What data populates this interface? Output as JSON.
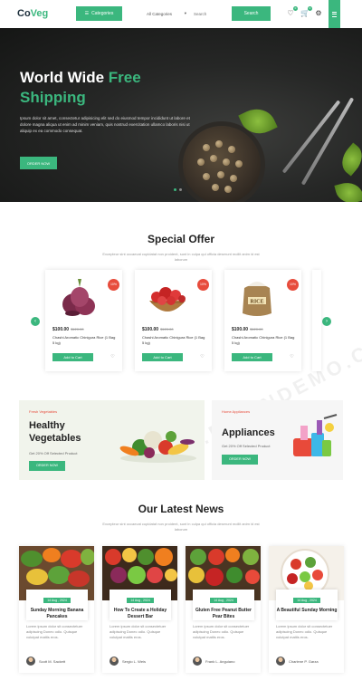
{
  "header": {
    "logo_main": "Co",
    "logo_accent": "Veg",
    "categories_button": "Categories",
    "category_select": "All Categories",
    "search_placeholder": "Search",
    "search_button": "Search",
    "wishlist_count": "0",
    "cart_count": "0"
  },
  "hero": {
    "title_line1": "World Wide",
    "title_accent": "Free",
    "title_line2": "Shipping",
    "description": "Ipsum dolor sit amet, consectetur adipisicing elit sed do eiusmod tempor incididunt ut labore et dolore magna aliqua ut enim ad minim veniam, quis nostrud exercitation ullamco laboris nisi ut aliquip ex ea commodo consequat.",
    "button": "ORDER NOW"
  },
  "special_offer": {
    "title": "Special Offer",
    "subtitle": "Excepteur sint occaecat cupidatat non proident, sunt in culpa qui officia deserunt mollit anim id est laborum",
    "products": [
      {
        "discount": "10%",
        "price": "$100.00",
        "old_price": "$120.00",
        "name": "Chashi Aromatic Chinigura Rice (1 Bag 5 kg)",
        "button": "Add to Cart"
      },
      {
        "discount": "10%",
        "price": "$100.00",
        "old_price": "$120.00",
        "name": "Chashi Aromatic Chinigura Rice (1 Bag 5 kg)",
        "button": "Add to Cart"
      },
      {
        "discount": "10%",
        "price": "$100.00",
        "old_price": "$120.00",
        "name": "Chashi Aromatic Chinigura Rice (1 Bag 5 kg)",
        "button": "Add to Cart"
      }
    ],
    "rice_label": "RICE"
  },
  "banners": [
    {
      "tag": "Fresh Vegetables",
      "title_line1": "Healthy",
      "title_line2": "Vegetables",
      "subtitle": "Get 20% Off Selected Product",
      "button": "ORDER NOW"
    },
    {
      "tag": "Home Appliances",
      "title_line1": "Appliances",
      "subtitle": "Get 20% Off Selected Product",
      "button": "ORDER NOW"
    }
  ],
  "news": {
    "title": "Our Latest News",
    "subtitle": "Excepteur sint occaecat cupidatat non proident, sunt in culpa qui officia deserunt mollit anim id est laborum",
    "posts": [
      {
        "date": "14 Aug , 2024",
        "title": "Sunday Morning Banana Pancakes",
        "excerpt": "Lorem ipsum dolor sit consectetuer adipiscing Donec odio. Quisque volutpat mattis eros.",
        "author": "Scott M. Sackett"
      },
      {
        "date": "14 Aug , 2024",
        "title": "How To Create a Holiday Dessert Bar",
        "excerpt": "Lorem ipsum dolor sit consectetuer adipiscing Donec odio. Quisque volutpat mattis eros.",
        "author": "Sergio L. Weis"
      },
      {
        "date": "14 Aug , 2024",
        "title": "Gluten Free Peanut Butter Pear Bites",
        "excerpt": "Lorem ipsum dolor sit consectetuer adipiscing Donec odio. Quisque volutpat mattis eros.",
        "author": "Frank L. Anguiano"
      },
      {
        "date": "14 Aug , 2024",
        "title": "A Beautiful Sunday Morning",
        "excerpt": "Lorem ipsum dolor sit consectetuer adipiscing Donec odio. Quisque volutpat mattis eros.",
        "author": "Charlene P. Garza"
      }
    ]
  },
  "colors": {
    "brand": "#3bb77e",
    "discount": "#e74c3c",
    "hero_bg": "#1e1f1e"
  },
  "icons": [
    "menu-icon",
    "heart-icon",
    "cart-icon",
    "user-icon",
    "chevron-left-icon",
    "chevron-right-icon"
  ]
}
